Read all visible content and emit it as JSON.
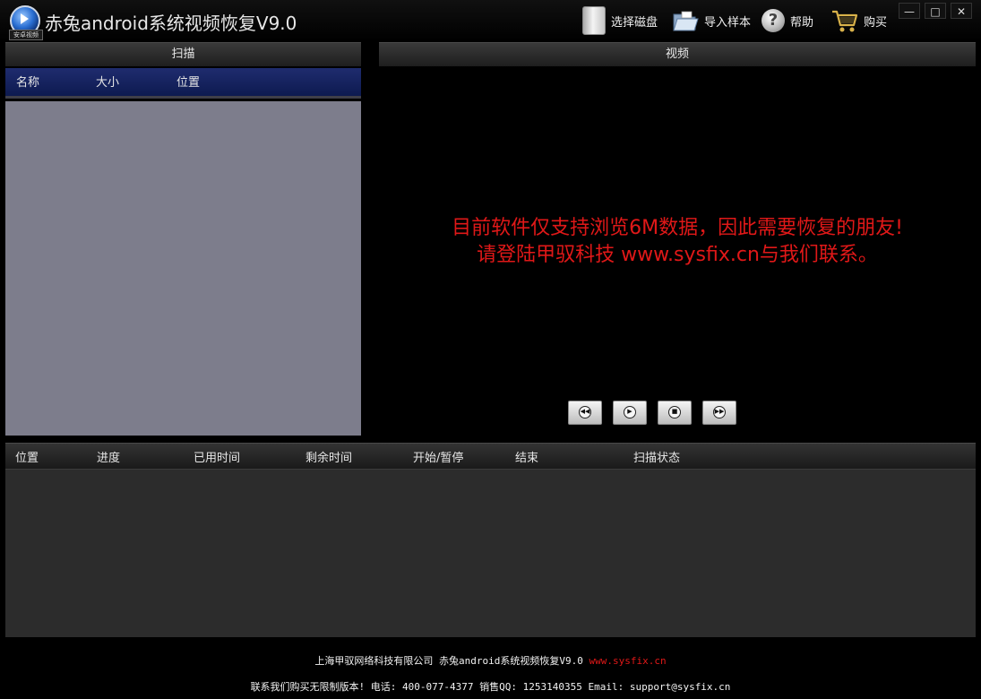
{
  "app": {
    "title": "赤兔android系统视频恢复V9.0",
    "logo_text": "安卓视频"
  },
  "toolbar": {
    "select_disk": "选择磁盘",
    "import_sample": "导入样本",
    "help": "帮助",
    "buy": "购买"
  },
  "window_controls": {
    "minimize": "—",
    "maximize": "□",
    "close": "✕"
  },
  "scan_panel": {
    "header": "扫描",
    "columns": [
      "名称",
      "大小",
      "位置"
    ]
  },
  "video_panel": {
    "header": "视频",
    "message_line1": "目前软件仅支持浏览6M数据，因此需要恢复的朋友!",
    "message_line2": "请登陆甲驭科技 www.sysfix.cn与我们联系。",
    "controls": {
      "prev": "◀◀",
      "play": "▶",
      "stop": "■",
      "next": "▶▶"
    }
  },
  "task_panel": {
    "columns": [
      "位置",
      "进度",
      "已用时间",
      "剩余时间",
      "开始/暂停",
      "结束",
      "扫描状态"
    ]
  },
  "footer": {
    "line1_text": "上海甲驭网络科技有限公司 赤兔android系统视频恢复V9.0",
    "line1_url": "www.sysfix.cn",
    "line2": "联系我们购买无限制版本! 电话: 400-077-4377 销售QQ: 1253140355 Email: support@sysfix.cn"
  },
  "colors": {
    "message_red": "#e01818",
    "column_header_blue": "#1f2c6e",
    "scan_list_gray": "#7d7d8c"
  }
}
